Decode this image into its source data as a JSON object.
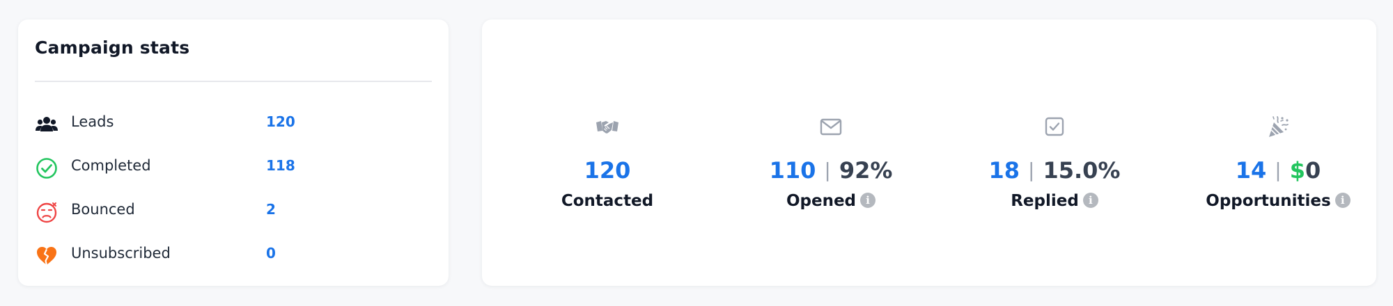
{
  "campaign_stats": {
    "title": "Campaign stats",
    "rows": [
      {
        "label": "Leads",
        "value": "120",
        "icon": "users-icon"
      },
      {
        "label": "Completed",
        "value": "118",
        "icon": "check-circle-icon"
      },
      {
        "label": "Bounced",
        "value": "2",
        "icon": "sad-face-icon"
      },
      {
        "label": "Unsubscribed",
        "value": "0",
        "icon": "broken-heart-icon"
      }
    ]
  },
  "metrics": [
    {
      "label": "Contacted",
      "primary": "120",
      "icon": "handshake-icon"
    },
    {
      "label": "Opened",
      "primary": "110",
      "secondary": "92%",
      "icon": "envelope-icon",
      "info": "i"
    },
    {
      "label": "Replied",
      "primary": "18",
      "secondary": "15.0%",
      "icon": "checkbox-icon",
      "info": "i"
    },
    {
      "label": "Opportunities",
      "primary": "14",
      "currency": "$",
      "secondary": "0",
      "icon": "party-popper-icon",
      "info": "i"
    }
  ],
  "separator": "|",
  "colors": {
    "accent_blue": "#1a73e8",
    "dark_text": "#111827",
    "money_green": "#22c55e",
    "completed_green": "#22c55e",
    "bounced_red": "#ef4444",
    "unsubscribed_orange": "#f97316",
    "icon_gray": "#9ca3af"
  }
}
